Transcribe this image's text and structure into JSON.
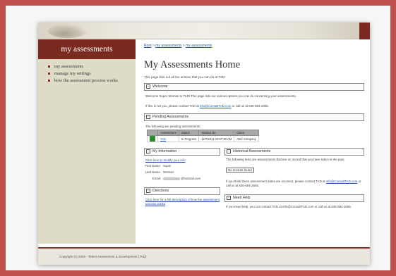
{
  "sidebar": {
    "title": "my assessments",
    "items": [
      {
        "label": "my assessments"
      },
      {
        "label": "manage my settings"
      },
      {
        "label": "how the assessment process works"
      }
    ]
  },
  "breadcrumb": {
    "items": [
      "Root",
      "my assessments",
      "my assessments"
    ],
    "separator": ">"
  },
  "page": {
    "title": "My Assessments Home",
    "intro": "This page lists out all the actions that you can do at TAD."
  },
  "welcome": {
    "heading": "Welcome",
    "message": "Welcome Super Woman to TAD! This page lists our various options you can do concerning your assessments.",
    "contact_prefix": "If this is not you, please contact TAD at",
    "contact_email": "info@ConsultTAD.com",
    "contact_suffix": "or call us at 636-684-2655."
  },
  "pending": {
    "heading": "Pending Assessments",
    "intro": "The following are pending assessments:",
    "columns": [
      "",
      "Assessment",
      "Status",
      "Started On",
      "Client"
    ],
    "rows": [
      {
        "assessment": "TAD",
        "status": "In Progress",
        "started_on": "11/7/2014 10:07:30 AM",
        "client": "ABC Company"
      }
    ]
  },
  "my_info": {
    "heading": "My Information",
    "modify_link": "Click here to modify your info",
    "first_name_label": "First Name:",
    "first_name": "Supm",
    "last_name_label": "Last Name:",
    "last_name": "Woman",
    "email_label": "Email:",
    "email_suffix": "@hotmail.com"
  },
  "historical": {
    "heading": "Historical Assessments",
    "intro": "The following links are assessments that are on record that you have taken in the past.",
    "no_records": "No records found",
    "note_prefix": "If you think these assessment dates are incorrect, please contact TAD at",
    "note_email": "info@ConsultTAD.com",
    "note_suffix": "or call us at 636-684-2655."
  },
  "directions": {
    "heading": "Directions",
    "link": "Click here for a full description of how the assessment process works"
  },
  "help": {
    "heading": "Need Help",
    "text": "If you need help, you can contact TAD at info@ConsultTAD.com or call us at 636-684-2655."
  },
  "footer": {
    "text": "Copyright (c) 2009 - Talent Assessment & Development (TAD)"
  },
  "colors": {
    "accent": "#7a2a1f",
    "frame": "#c0504d",
    "link": "#2255aa",
    "sidebar_bg": "#dedbc6"
  }
}
